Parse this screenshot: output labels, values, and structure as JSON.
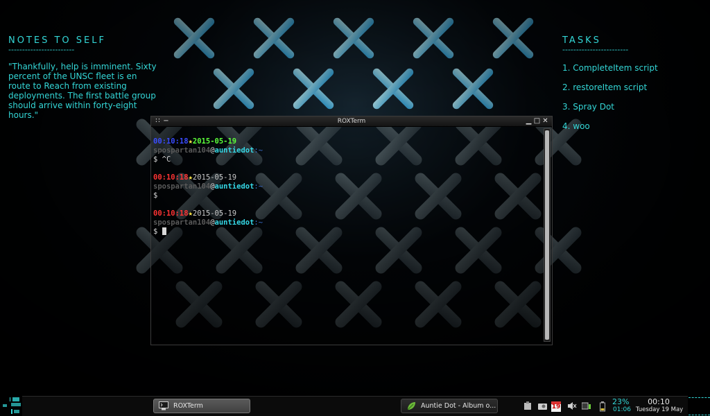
{
  "notes": {
    "title": "NOTES TO SELF",
    "rule": "------------------------",
    "quote": "\"Thankfully, help is imminent. Sixty percent of the UNSC fleet is en route to Reach from existing deployments. The first battle group should arrive within forty-eight hours.\""
  },
  "tasks": {
    "title": "TASKS",
    "rule": "------------------------",
    "items": [
      "1. CompleteItem script",
      "2. restoreItem script",
      "3. Spray Dot",
      "4. woo"
    ]
  },
  "terminal": {
    "title": "ROXTerm",
    "blocks": [
      {
        "time": "00:10:18",
        "star": "★",
        "date": "2015-05-19",
        "user": "spospartan104",
        "at": "@",
        "host": "auntiedot",
        "sep": ":",
        "path": "~",
        "prompt": "$ ",
        "input": "^C"
      },
      {
        "time": "00:10:18",
        "star": "★",
        "date": "2015-05-19",
        "user": "spospartan104",
        "at": "@",
        "host": "auntiedot",
        "sep": ":",
        "path": "~",
        "prompt": "$",
        "input": ""
      },
      {
        "time": "00:10:18",
        "star": "★",
        "date": "2015-05-19",
        "user": "spospartan104",
        "at": "@",
        "host": "auntiedot",
        "sep": ":",
        "path": "~",
        "prompt": "$ ",
        "input": ""
      }
    ]
  },
  "taskbar": {
    "windows": [
      {
        "label": "ROXTerm",
        "icon": "terminal-icon",
        "active": true
      },
      {
        "label": "Auntie Dot - Album o...",
        "icon": "leaf-icon",
        "active": false
      }
    ],
    "calendar_day": "19",
    "battery_percent": "23%",
    "battery_time": "01:06",
    "clock_time": "00:10",
    "clock_date": "Tuesday 19 May"
  },
  "colors": {
    "conky": "#33d6d6",
    "time_blue": "#3a4cff",
    "time_red": "#ff3333",
    "date_green": "#5cff3a",
    "host_cyan": "#35d8e6"
  }
}
